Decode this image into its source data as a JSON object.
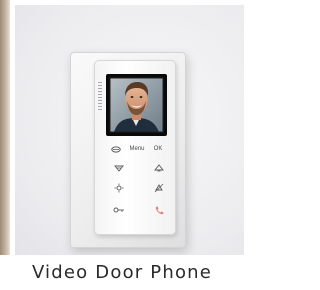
{
  "caption": "Video Door Phone",
  "panel": {
    "menu_label": "Menu",
    "ok_label": "OK"
  },
  "icons": {
    "talk": "talk-icon",
    "menu": "menu-label",
    "ok": "ok-label",
    "wifi": "wifi-icon",
    "bell": "bell-icon",
    "light": "light-icon",
    "mute": "mute-icon",
    "key": "key-icon",
    "handset": "handset-icon"
  },
  "colors": {
    "handset_accent": "#e07b86",
    "device_body": "#f4f4f4",
    "screen": "#0a0a0a",
    "caption_text": "#2a2a2a"
  }
}
